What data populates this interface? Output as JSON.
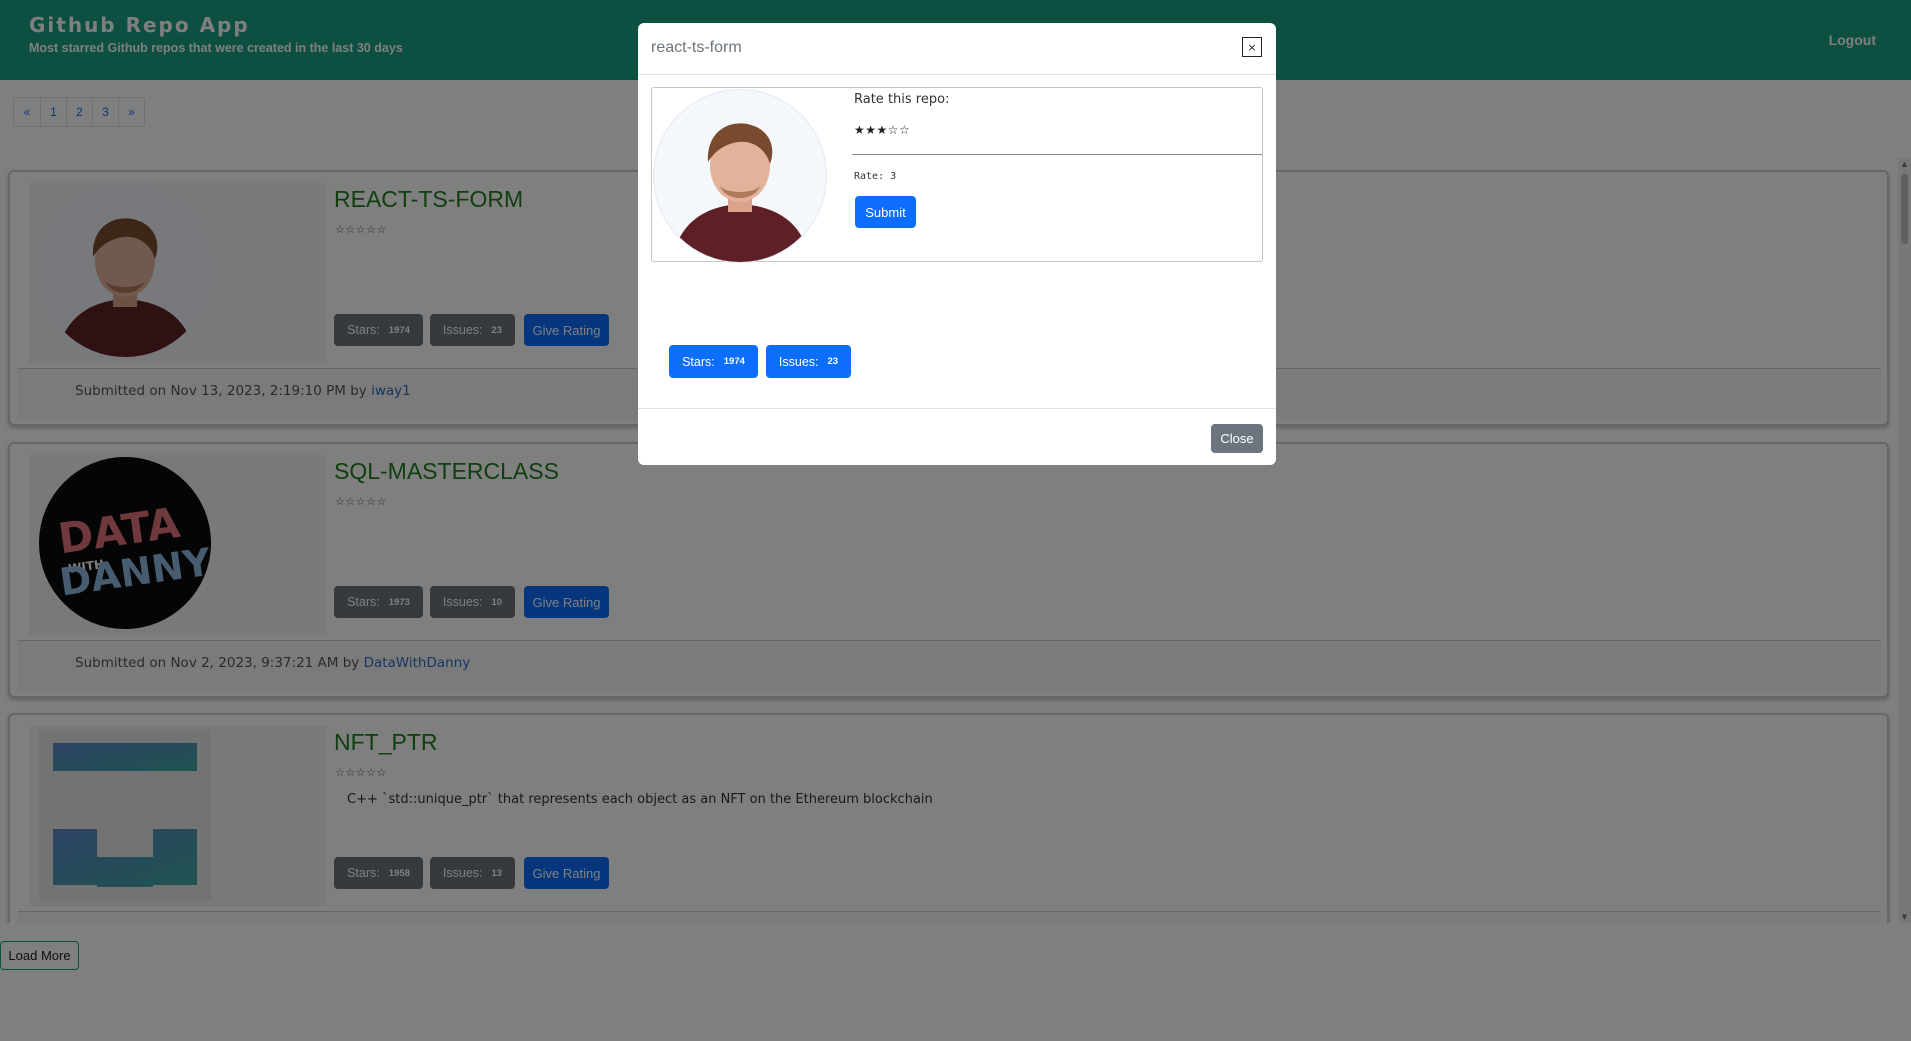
{
  "header": {
    "title": "Github Repo App",
    "subtitle": "Most starred Github repos that were created in the last 30 days",
    "logout_label": "Logout"
  },
  "pagination": {
    "items": [
      "«",
      "1",
      "2",
      "3",
      "»"
    ]
  },
  "repos": [
    {
      "name": "REACT-TS-FORM",
      "rating_stars": "☆☆☆☆☆",
      "description": "",
      "stars_label": "Stars:",
      "stars_count": "1974",
      "issues_label": "Issues:",
      "issues_count": "23",
      "rating_button": "Give Rating",
      "submitted_text": "Submitted on Nov 13, 2023, 2:19:10 PM by",
      "author": "iway1"
    },
    {
      "name": "SQL-MASTERCLASS",
      "rating_stars": "☆☆☆☆☆",
      "description": "",
      "stars_label": "Stars:",
      "stars_count": "1973",
      "issues_label": "Issues:",
      "issues_count": "10",
      "rating_button": "Give Rating",
      "submitted_text": "Submitted on Nov 2, 2023, 9:37:21 AM by",
      "author": "DataWithDanny",
      "logo_text": {
        "top": "DATA",
        "with": "WITH",
        "bottom": "DANNY"
      }
    },
    {
      "name": "NFT_PTR",
      "rating_stars": "☆☆☆☆☆",
      "description": "C++ `std::unique_ptr` that represents each object as an NFT on the Ethereum blockchain",
      "stars_label": "Stars:",
      "stars_count": "1958",
      "issues_label": "Issues:",
      "issues_count": "13",
      "rating_button": "Give Rating"
    }
  ],
  "load_more_label": "Load More",
  "modal": {
    "title": "react-ts-form",
    "close_x": "×",
    "rate_label": "Rate this repo:",
    "rate_stars": "★★★☆☆",
    "rate_value_text": "Rate: 3",
    "submit_label": "Submit",
    "stars_label": "Stars:",
    "stars_count": "1974",
    "issues_label": "Issues:",
    "issues_count": "23",
    "close_label": "Close"
  },
  "colors": {
    "header_bg": "#1a9e82",
    "primary": "#0d6efd",
    "secondary": "#6c757d",
    "title_green": "#1f7d1f",
    "link_blue": "#2a6ebd"
  }
}
